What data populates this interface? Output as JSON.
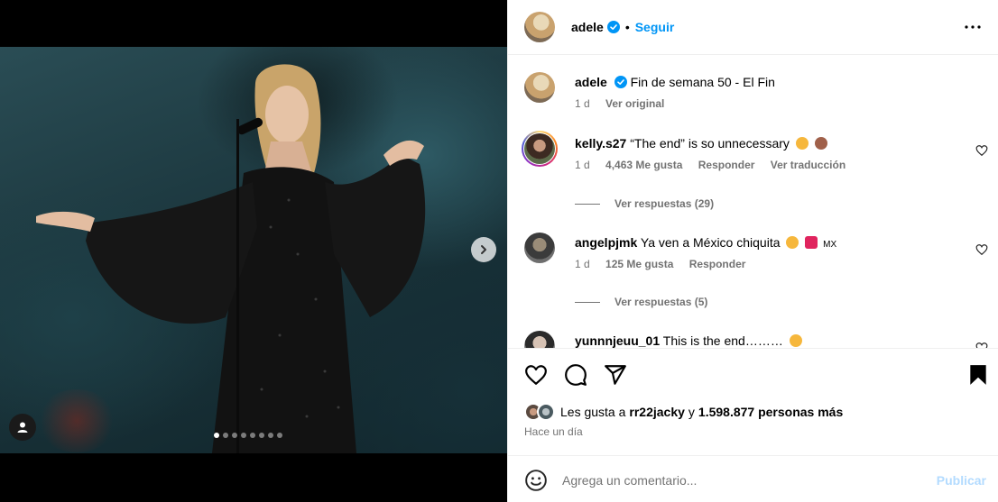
{
  "post": {
    "username": "adele",
    "separator": "•",
    "follow_label": "Seguir",
    "caption": {
      "username": "adele",
      "text": "Fin de semana 50 - El Fin",
      "time": "1 d",
      "see_original": "Ver original"
    },
    "carousel": {
      "slides": 8,
      "active_index": 0
    }
  },
  "comments": [
    {
      "username": "kelly.s27",
      "text": "“The end” is so unnecessary",
      "time": "1 d",
      "likes": "4,463 Me gusta",
      "reply": "Responder",
      "translate": "Ver traducción",
      "replies": "Ver respuestas (29)"
    },
    {
      "username": "angelpjmk",
      "text": "Ya ven a México chiquita",
      "flag": "MX",
      "time": "1 d",
      "likes": "125 Me gusta",
      "reply": "Responder",
      "replies": "Ver respuestas (5)"
    },
    {
      "username": "yunnnjeuu_01",
      "text": "This is the end………"
    }
  ],
  "likes": {
    "prefix": "Les gusta a",
    "user": "rr22jacky",
    "conjunction": "y",
    "others": "1.598.877 personas más"
  },
  "timestamp": "Hace un día",
  "composer": {
    "placeholder": "Agrega un comentario...",
    "publish_label": "Publicar"
  },
  "colors": {
    "accent": "#0095f6",
    "muted": "#737373",
    "publish_disabled": "#b3dbff",
    "verified": "#0095f6"
  }
}
